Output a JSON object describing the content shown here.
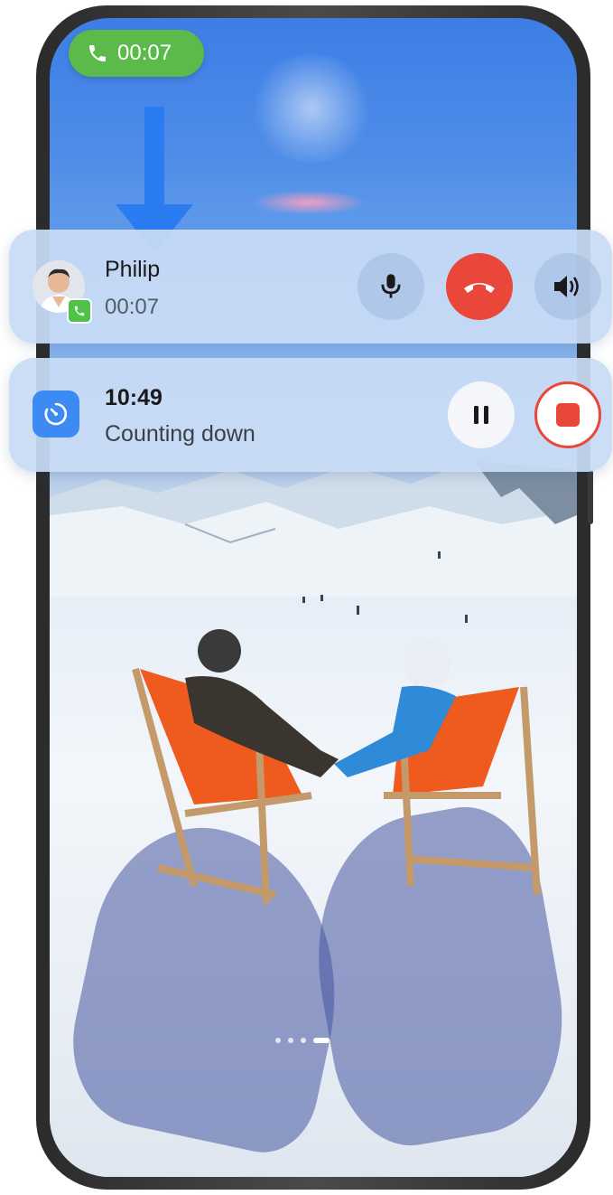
{
  "call_pill": {
    "duration": "00:07",
    "icon": "phone-icon",
    "color": "#5cba4a"
  },
  "call_card": {
    "caller_name": "Philip",
    "duration": "00:07",
    "mic_icon": "microphone-icon",
    "hangup_icon": "hang-up-icon",
    "speaker_icon": "speaker-icon",
    "hangup_color": "#e8473a"
  },
  "timer_card": {
    "time": "10:49",
    "status": "Counting down",
    "app_icon": "timer-icon",
    "pause_icon": "pause-icon",
    "stop_icon": "stop-icon"
  },
  "home": {
    "page_count": 4,
    "active_page": 4
  }
}
